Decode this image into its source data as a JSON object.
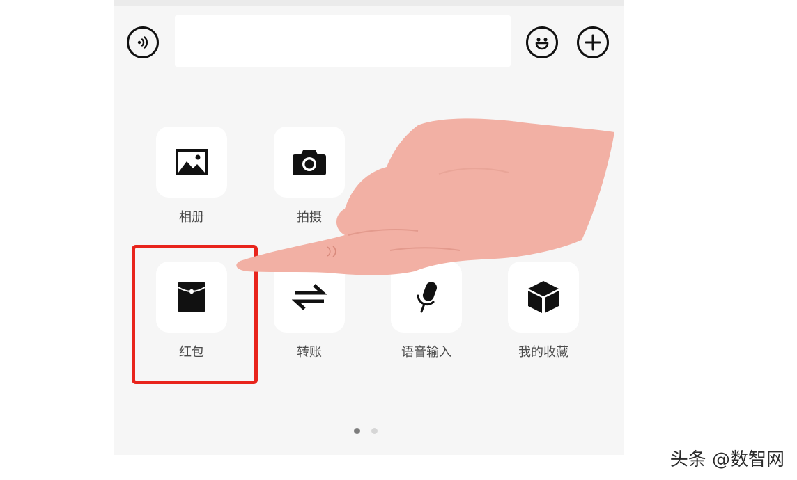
{
  "input_bar": {
    "text_value": "",
    "icons": {
      "voice": "voice-wave-icon",
      "emoji": "smiley-face-icon",
      "more": "plus-circle-icon"
    }
  },
  "tiles": [
    {
      "label": "相册",
      "icon": "image-icon"
    },
    {
      "label": "拍摄",
      "icon": "camera-icon"
    },
    {
      "label": "红包",
      "icon": "red-packet-icon"
    },
    {
      "label": "转账",
      "icon": "transfer-arrows-icon"
    },
    {
      "label": "语音输入",
      "icon": "microphone-icon"
    },
    {
      "label": "我的收藏",
      "icon": "cube-icon"
    }
  ],
  "pager": {
    "current_page": 1,
    "total_pages": 2
  },
  "annotation": {
    "highlight_color": "#e8241c",
    "pointer": "pointing-hand-illustration"
  },
  "watermark": "头条 @数智网"
}
